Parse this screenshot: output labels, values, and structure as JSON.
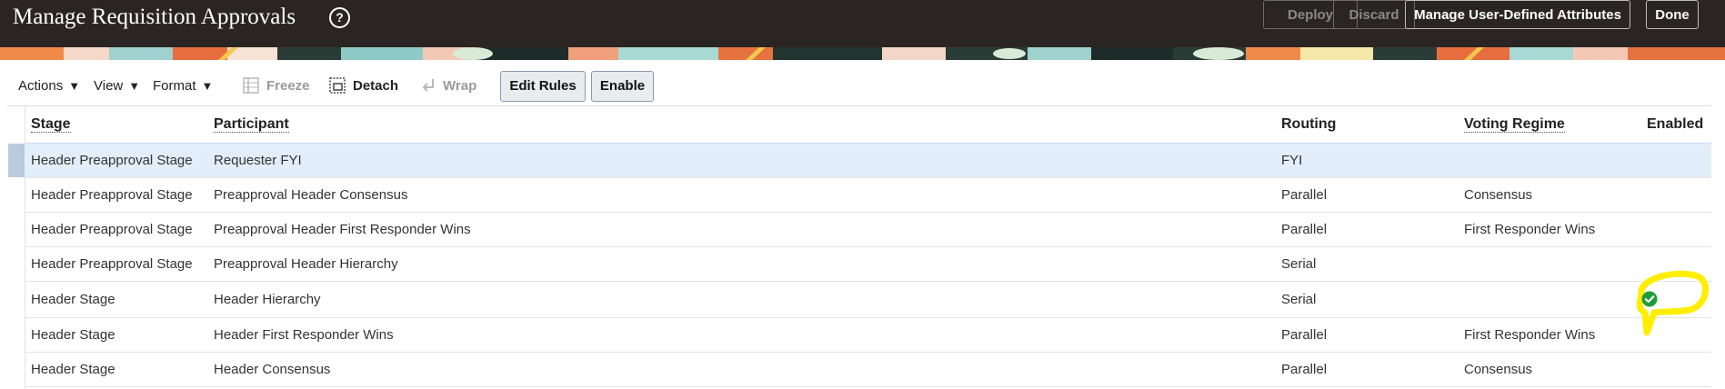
{
  "page": {
    "title": "Manage Requisition Approvals",
    "help_icon": "help-circle-icon"
  },
  "header_buttons": {
    "deploy": "Deploy",
    "discard": "Discard",
    "manage_attributes": "Manage User-Defined Attributes",
    "done": "Done"
  },
  "toolbar": {
    "actions": "Actions",
    "view": "View",
    "format": "Format",
    "freeze": "Freeze",
    "detach": "Detach",
    "wrap": "Wrap",
    "edit_rules": "Edit Rules",
    "enable": "Enable"
  },
  "table": {
    "columns": {
      "stage": "Stage",
      "participant": "Participant",
      "routing": "Routing",
      "voting": "Voting Regime",
      "enabled": "Enabled"
    },
    "rows": [
      {
        "stage": "Header Preapproval Stage",
        "participant": "Requester FYI",
        "routing": "FYI",
        "voting": "",
        "enabled": false
      },
      {
        "stage": "Header Preapproval Stage",
        "participant": "Preapproval Header Consensus",
        "routing": "Parallel",
        "voting": "Consensus",
        "enabled": false
      },
      {
        "stage": "Header Preapproval Stage",
        "participant": "Preapproval Header First Responder Wins",
        "routing": "Parallel",
        "voting": "First Responder Wins",
        "enabled": false
      },
      {
        "stage": "Header Preapproval Stage",
        "participant": "Preapproval Header Hierarchy",
        "routing": "Serial",
        "voting": "",
        "enabled": false
      },
      {
        "stage": "Header Stage",
        "participant": "Header Hierarchy",
        "routing": "Serial",
        "voting": "",
        "enabled": true
      },
      {
        "stage": "Header Stage",
        "participant": "Header First Responder Wins",
        "routing": "Parallel",
        "voting": "First Responder Wins",
        "enabled": false
      },
      {
        "stage": "Header Stage",
        "participant": "Header Consensus",
        "routing": "Parallel",
        "voting": "Consensus",
        "enabled": false
      }
    ]
  },
  "colors": {
    "header_bg": "#2a2522",
    "selected_row": "#e2eef9",
    "enabled_check": "#1f9d3a",
    "highlight_marker": "#ffee00"
  }
}
